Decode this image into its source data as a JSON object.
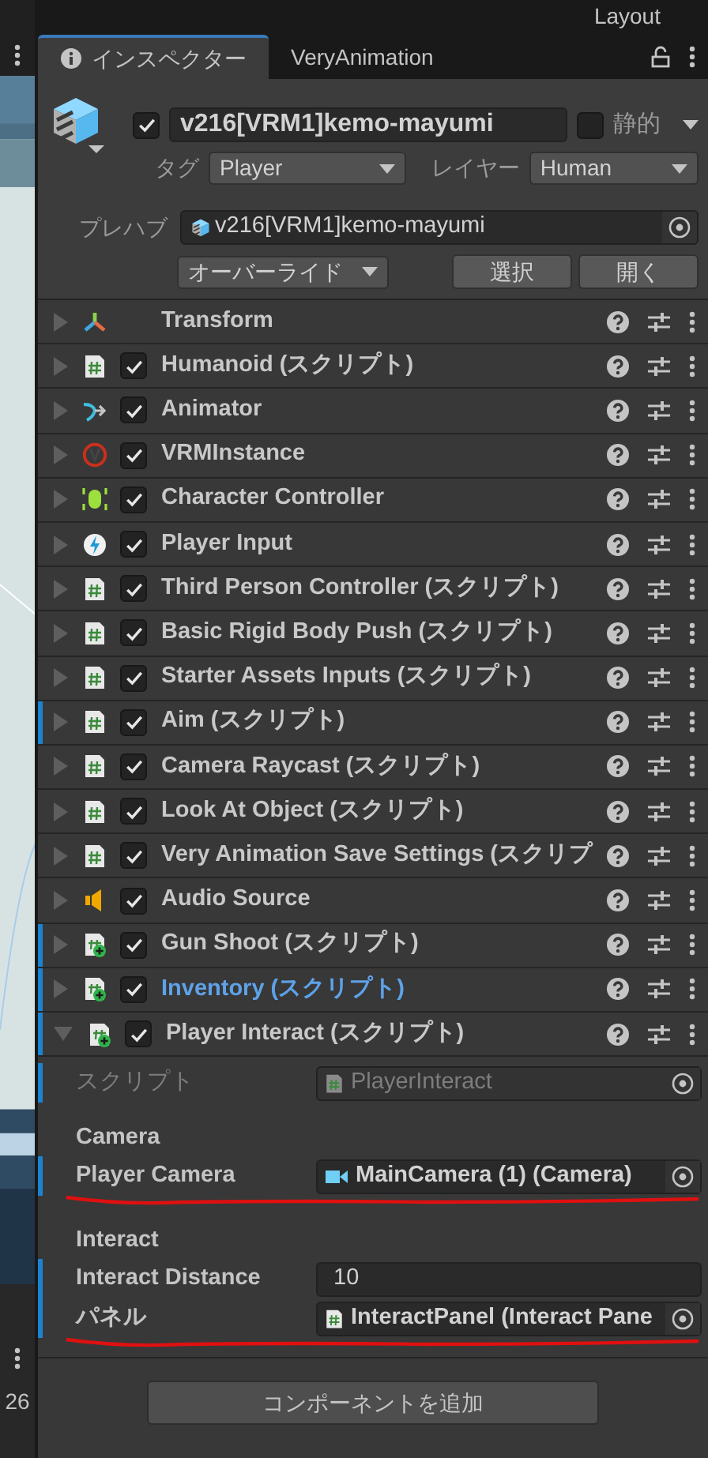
{
  "top_bar": {
    "layout_label": "Layout"
  },
  "left_panel": {
    "count": "26"
  },
  "tabs": [
    {
      "label": "インスペクター",
      "selected": true
    },
    {
      "label": "VeryAnimation",
      "selected": false
    }
  ],
  "object": {
    "active": true,
    "name": "v216[VRM1]kemo-mayumi",
    "static": false,
    "static_label": "静的",
    "tag_label": "タグ",
    "tag": "Player",
    "layer_label": "レイヤー",
    "layer": "Human"
  },
  "prefab": {
    "label": "プレハブ",
    "asset": "v216[VRM1]kemo-mayumi",
    "overrides": "オーバーライド",
    "buttons": [
      "選択",
      "開く"
    ]
  },
  "components": [
    {
      "kind": "transform",
      "name": "Transform",
      "expanded": false,
      "override_bar": false,
      "highlighted": false
    },
    {
      "kind": "script",
      "name": "Humanoid (スクリプト)",
      "enabled": true,
      "expanded": false,
      "override_bar": false,
      "highlighted": false
    },
    {
      "kind": "animator",
      "name": "Animator",
      "enabled": true,
      "expanded": false,
      "override_bar": false,
      "highlighted": false
    },
    {
      "kind": "vrm",
      "name": "VRMInstance",
      "enabled": true,
      "expanded": false,
      "override_bar": false,
      "highlighted": false
    },
    {
      "kind": "controller",
      "name": "Character Controller",
      "enabled": true,
      "expanded": false,
      "override_bar": false,
      "highlighted": false
    },
    {
      "kind": "input",
      "name": "Player Input",
      "enabled": true,
      "expanded": false,
      "override_bar": false,
      "highlighted": false
    },
    {
      "kind": "script",
      "name": "Third Person Controller (スクリプト)",
      "enabled": true,
      "expanded": false,
      "override_bar": false,
      "highlighted": false
    },
    {
      "kind": "script",
      "name": "Basic Rigid Body Push (スクリプト)",
      "enabled": true,
      "expanded": false,
      "override_bar": false,
      "highlighted": false
    },
    {
      "kind": "script",
      "name": "Starter Assets Inputs (スクリプト)",
      "enabled": true,
      "expanded": false,
      "override_bar": false,
      "highlighted": false
    },
    {
      "kind": "script",
      "name": "Aim (スクリプト)",
      "enabled": true,
      "expanded": false,
      "override_bar": true,
      "highlighted": false
    },
    {
      "kind": "script",
      "name": "Camera Raycast (スクリプト)",
      "enabled": true,
      "expanded": false,
      "override_bar": false,
      "highlighted": false
    },
    {
      "kind": "script",
      "name": "Look At Object (スクリプト)",
      "enabled": true,
      "expanded": false,
      "override_bar": false,
      "highlighted": false
    },
    {
      "kind": "script",
      "name": "Very Animation Save Settings (スクリプ",
      "enabled": true,
      "expanded": false,
      "override_bar": false,
      "highlighted": false
    },
    {
      "kind": "audio",
      "name": "Audio Source",
      "enabled": true,
      "expanded": false,
      "override_bar": false,
      "highlighted": false
    },
    {
      "kind": "added_script",
      "name": "Gun Shoot (スクリプト)",
      "enabled": true,
      "expanded": false,
      "override_bar": true,
      "highlighted": false
    },
    {
      "kind": "added_script",
      "name": "Inventory (スクリプト)",
      "enabled": true,
      "expanded": false,
      "override_bar": true,
      "highlighted": true
    },
    {
      "kind": "added_script",
      "name": "Player Interact (スクリプト)",
      "enabled": true,
      "expanded": true,
      "override_bar": true,
      "highlighted": false
    }
  ],
  "fields": [
    {
      "kind": "script",
      "label": "スクリプト",
      "value": "PlayerInteract",
      "disabled": true,
      "override_bar": true
    },
    {
      "kind": "header",
      "label": "Camera"
    },
    {
      "kind": "camera",
      "label": "Player Camera",
      "value": "MainCamera (1) (Camera)",
      "disabled": false,
      "override_bar": true,
      "underlined": true
    },
    {
      "kind": "header",
      "label": "Interact"
    },
    {
      "kind": "number",
      "label": "Interact Distance",
      "value": "10",
      "disabled": false,
      "override_bar": true
    },
    {
      "kind": "component",
      "label": "パネル",
      "value": "InteractPanel (Interact Pane",
      "disabled": false,
      "override_bar": true,
      "underlined": true
    }
  ],
  "add_component": "コンポーネントを追加"
}
